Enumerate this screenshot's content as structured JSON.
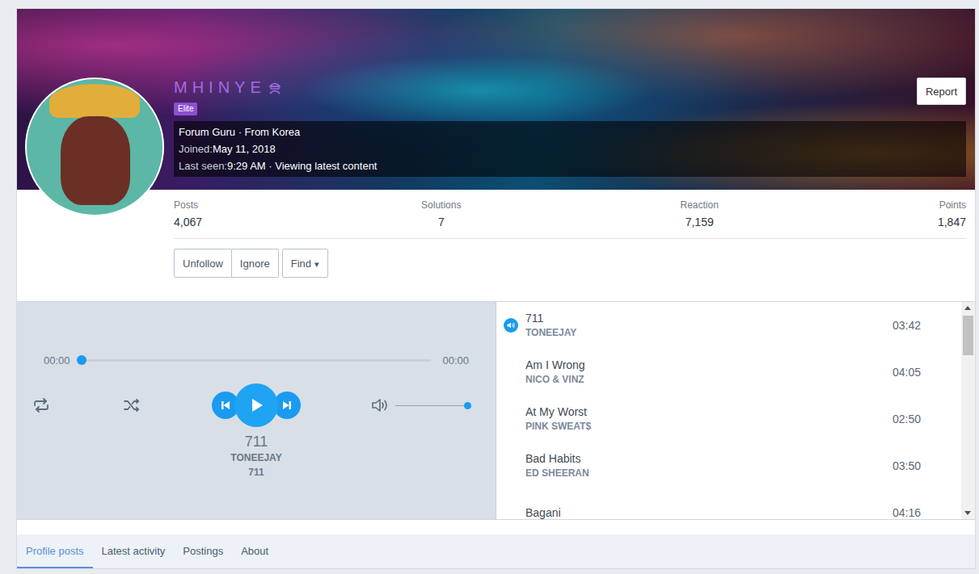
{
  "profile": {
    "username": "MHINYE",
    "badge": "Elite",
    "title_line": "Forum Guru · From Korea",
    "joined_label": "Joined:",
    "joined": "May 11, 2018",
    "last_seen_label": "Last seen:",
    "last_seen": "9:29 AM · Viewing latest content"
  },
  "report_button": "Report",
  "stats": [
    {
      "label": "Posts",
      "value": "4,067"
    },
    {
      "label": "Solutions",
      "value": "7"
    },
    {
      "label": "Reaction",
      "value": "7,159"
    },
    {
      "label": "Points",
      "value": "1,847"
    }
  ],
  "actions": [
    "Unfollow",
    "Ignore"
  ],
  "find": {
    "label": "Find",
    "caret": "▾"
  },
  "player": {
    "elapsed": "00:00",
    "duration": "00:00",
    "progress": 0,
    "volume": 1,
    "playing": false,
    "now_playing": {
      "title": "711",
      "artist": "TONEEJAY",
      "album": "711"
    }
  },
  "playlist": [
    {
      "title": "711",
      "artist": "TONEEJAY",
      "duration": "03:42",
      "selected": true
    },
    {
      "title": "Am I Wrong",
      "artist": "NICO & VINZ",
      "duration": "04:05",
      "selected": false
    },
    {
      "title": "At My Worst",
      "artist": "PINK SWEAT$",
      "duration": "02:50",
      "selected": false
    },
    {
      "title": "Bad Habits",
      "artist": "ED SHEERAN",
      "duration": "03:50",
      "selected": false
    },
    {
      "title": "Bagani",
      "artist": "",
      "duration": "04:16",
      "selected": false
    }
  ],
  "tabs": [
    {
      "label": "Profile posts",
      "selected": true
    },
    {
      "label": "Latest activity",
      "selected": false
    },
    {
      "label": "Postings",
      "selected": false
    },
    {
      "label": "About",
      "selected": false
    }
  ]
}
